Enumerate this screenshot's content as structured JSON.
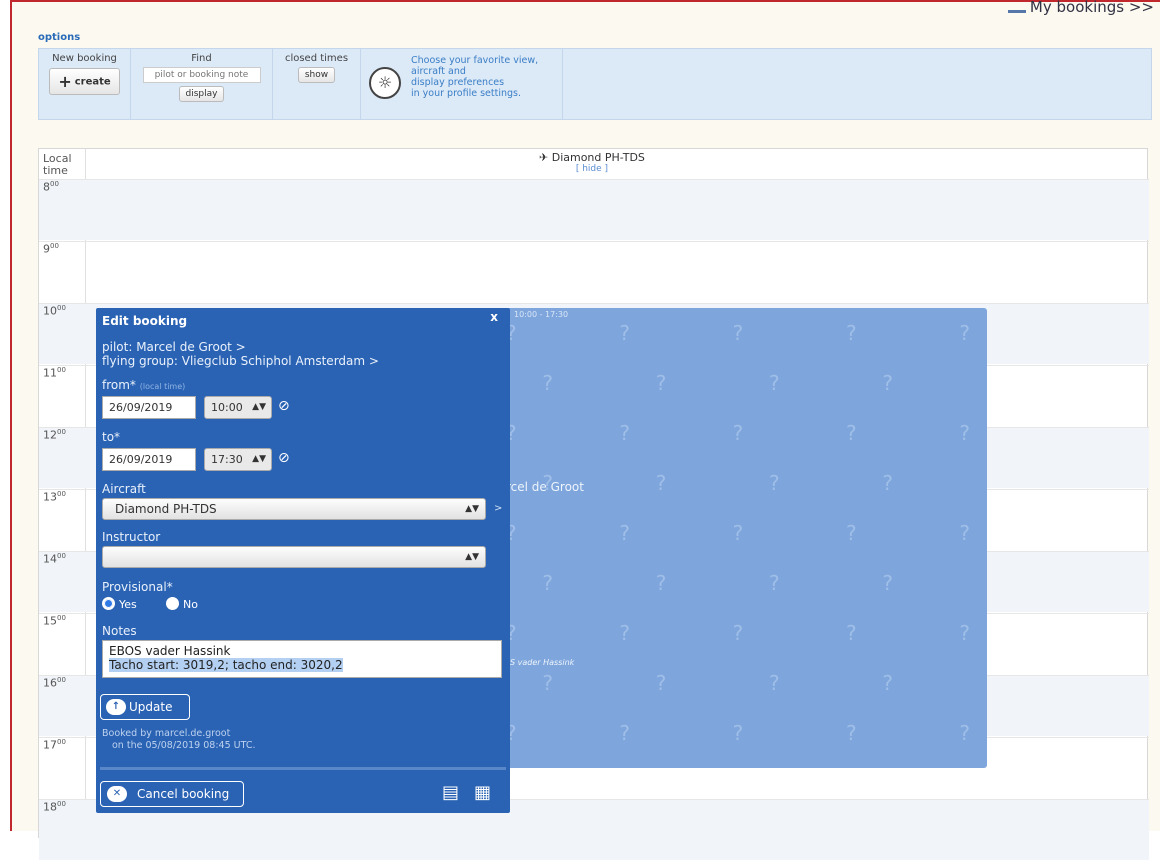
{
  "header": {
    "my_bookings": "My bookings >>",
    "options": "options"
  },
  "toolbar": {
    "new_booking": {
      "label": "New booking",
      "button": "create"
    },
    "find": {
      "label": "Find",
      "placeholder": "pilot or booking note",
      "button": "display"
    },
    "closed_times": {
      "label": "closed times",
      "button": "show"
    },
    "tip": {
      "line1": "Choose your favorite view,",
      "line2": "aircraft and",
      "line3": "display preferences",
      "line4": "in your profile settings."
    }
  },
  "calendar": {
    "local_time": "Local time",
    "aircraft": "Diamond PH-TDS",
    "hide": "[ hide ]",
    "hours": [
      {
        "h": "8",
        "m": "00"
      },
      {
        "h": "9",
        "m": "00"
      },
      {
        "h": "10",
        "m": "00"
      },
      {
        "h": "11",
        "m": "00"
      },
      {
        "h": "12",
        "m": "00"
      },
      {
        "h": "13",
        "m": "00"
      },
      {
        "h": "14",
        "m": "00"
      },
      {
        "h": "15",
        "m": "00"
      },
      {
        "h": "16",
        "m": "00"
      },
      {
        "h": "17",
        "m": "00"
      },
      {
        "h": "18",
        "m": "00"
      }
    ],
    "booking_block": {
      "time": "10:00 - 17:30",
      "pilot": "rcel de Groot",
      "note": "S vader Hassink"
    }
  },
  "dialog": {
    "title": "Edit booking",
    "close": "x",
    "pilot": "pilot: Marcel de Groot  >",
    "group": "flying group: Vliegclub Schiphol Amsterdam  >",
    "from_label": "from*",
    "local_time_hint": "(local time)",
    "from_date": "26/09/2019",
    "from_time": "10:00",
    "to_label": "to*",
    "to_date": "26/09/2019",
    "to_time": "17:30",
    "aircraft_label": "Aircraft",
    "aircraft_value": "Diamond PH-TDS",
    "instructor_label": "Instructor",
    "instructor_value": "",
    "provisional_label": "Provisional*",
    "yes": "Yes",
    "no": "No",
    "notes_label": "Notes",
    "notes_line1": "EBOS vader Hassink",
    "notes_line2": "Tacho start: 3019,2; tacho end: 3020,2",
    "update": "Update",
    "booked_by": "Booked by marcel.de.groot",
    "booked_on": "on the 05/08/2019 08:45 UTC.",
    "cancel": "Cancel booking"
  }
}
